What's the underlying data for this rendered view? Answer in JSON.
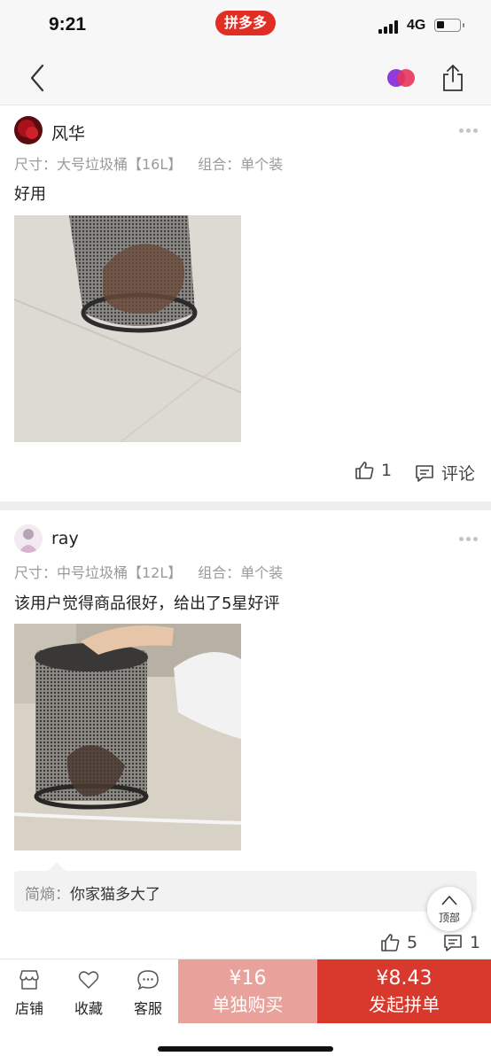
{
  "status_bar": {
    "time": "9:21",
    "app_badge": "拼多多",
    "network": "4G"
  },
  "nav": {
    "back_icon": "chevron-left-icon",
    "share_icon": "share-icon",
    "brand_icon": "pinduoduo-logo-icon"
  },
  "reviews": [
    {
      "username": "风华",
      "spec_size": "尺寸：大号垃圾桶【16L】",
      "spec_combo": "组合：单个装",
      "text": "好用",
      "likes": "1",
      "comment_label": "评论"
    },
    {
      "username": "ray",
      "spec_size": "尺寸：中号垃圾桶【12L】",
      "spec_combo": "组合：单个装",
      "text": "该用户觉得商品很好，给出了5星好评",
      "reply": {
        "name": "简熵：",
        "content": "你家猫多大了"
      },
      "likes": "5",
      "comments": "1"
    }
  ],
  "back_to_top": "顶部",
  "bottom_bar": {
    "store": "店铺",
    "favorite": "收藏",
    "service": "客服",
    "single_price": "¥16",
    "single_label": "单独购买",
    "group_price": "¥8.43",
    "group_label": "发起拼单"
  },
  "colors": {
    "brand_red": "#e02e24",
    "group_button": "#d9392d",
    "single_button": "#e9a29b"
  }
}
